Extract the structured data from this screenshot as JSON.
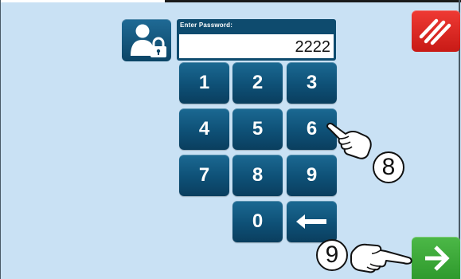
{
  "password_panel": {
    "label": "Enter Password:",
    "value": "2222"
  },
  "keypad": {
    "keys": [
      "1",
      "2",
      "3",
      "4",
      "5",
      "6",
      "7",
      "8",
      "9",
      "0"
    ]
  },
  "icons": {
    "user_lock": "user-lock-icon",
    "backspace": "arrow-left-icon",
    "cancel": "cancel-stripes-icon",
    "confirm": "arrow-right-icon",
    "pointing_hand": "pointing-hand-icon"
  },
  "annotations": {
    "step_8": "8",
    "step_9": "9"
  },
  "colors": {
    "background": "#c9e1f4",
    "key_blue": "#0e5076",
    "cancel_red": "#e1261f",
    "confirm_green": "#3aa838"
  }
}
